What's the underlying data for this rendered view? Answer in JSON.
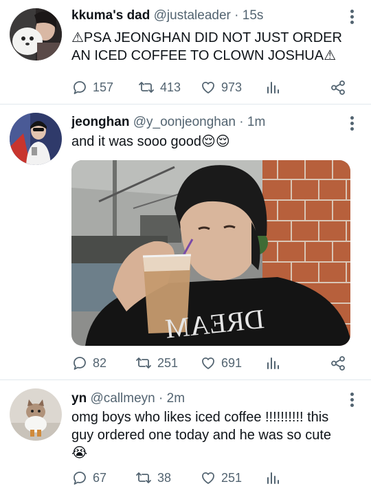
{
  "tweets": [
    {
      "name": "kkuma's dad",
      "handle": "@justaleader",
      "time": "· 15s",
      "text_line1": "⚠PSA JEONGHAN DID NOT JUST ORDER",
      "text_line2": "AN ICED COFFEE TO CLOWN JOSHUA⚠",
      "replies": "157",
      "retweets": "413",
      "likes": "973"
    },
    {
      "name": "jeonghan",
      "handle": "@y_oonjeonghan",
      "time": "· 1m",
      "text_line1": "and it was sooo good😌😌",
      "replies": "82",
      "retweets": "251",
      "likes": "691"
    },
    {
      "name": "yn",
      "handle": "@callmeyn",
      "time": "· 2m",
      "text_line1": "omg boys who likes iced coffee !!!!!!!!!! this",
      "text_line2": "guy ordered one today and he was so cute",
      "text_line3": "😭",
      "replies": "67",
      "retweets": "38",
      "likes": "251"
    }
  ],
  "icons": {
    "reply": "reply-icon",
    "retweet": "retweet-icon",
    "like": "heart-icon",
    "analytics": "analytics-icon",
    "share": "share-icon",
    "more": "more-icon"
  },
  "colors": {
    "text": "#0f1419",
    "secondary": "#536471",
    "divider": "#e1e8ed"
  }
}
